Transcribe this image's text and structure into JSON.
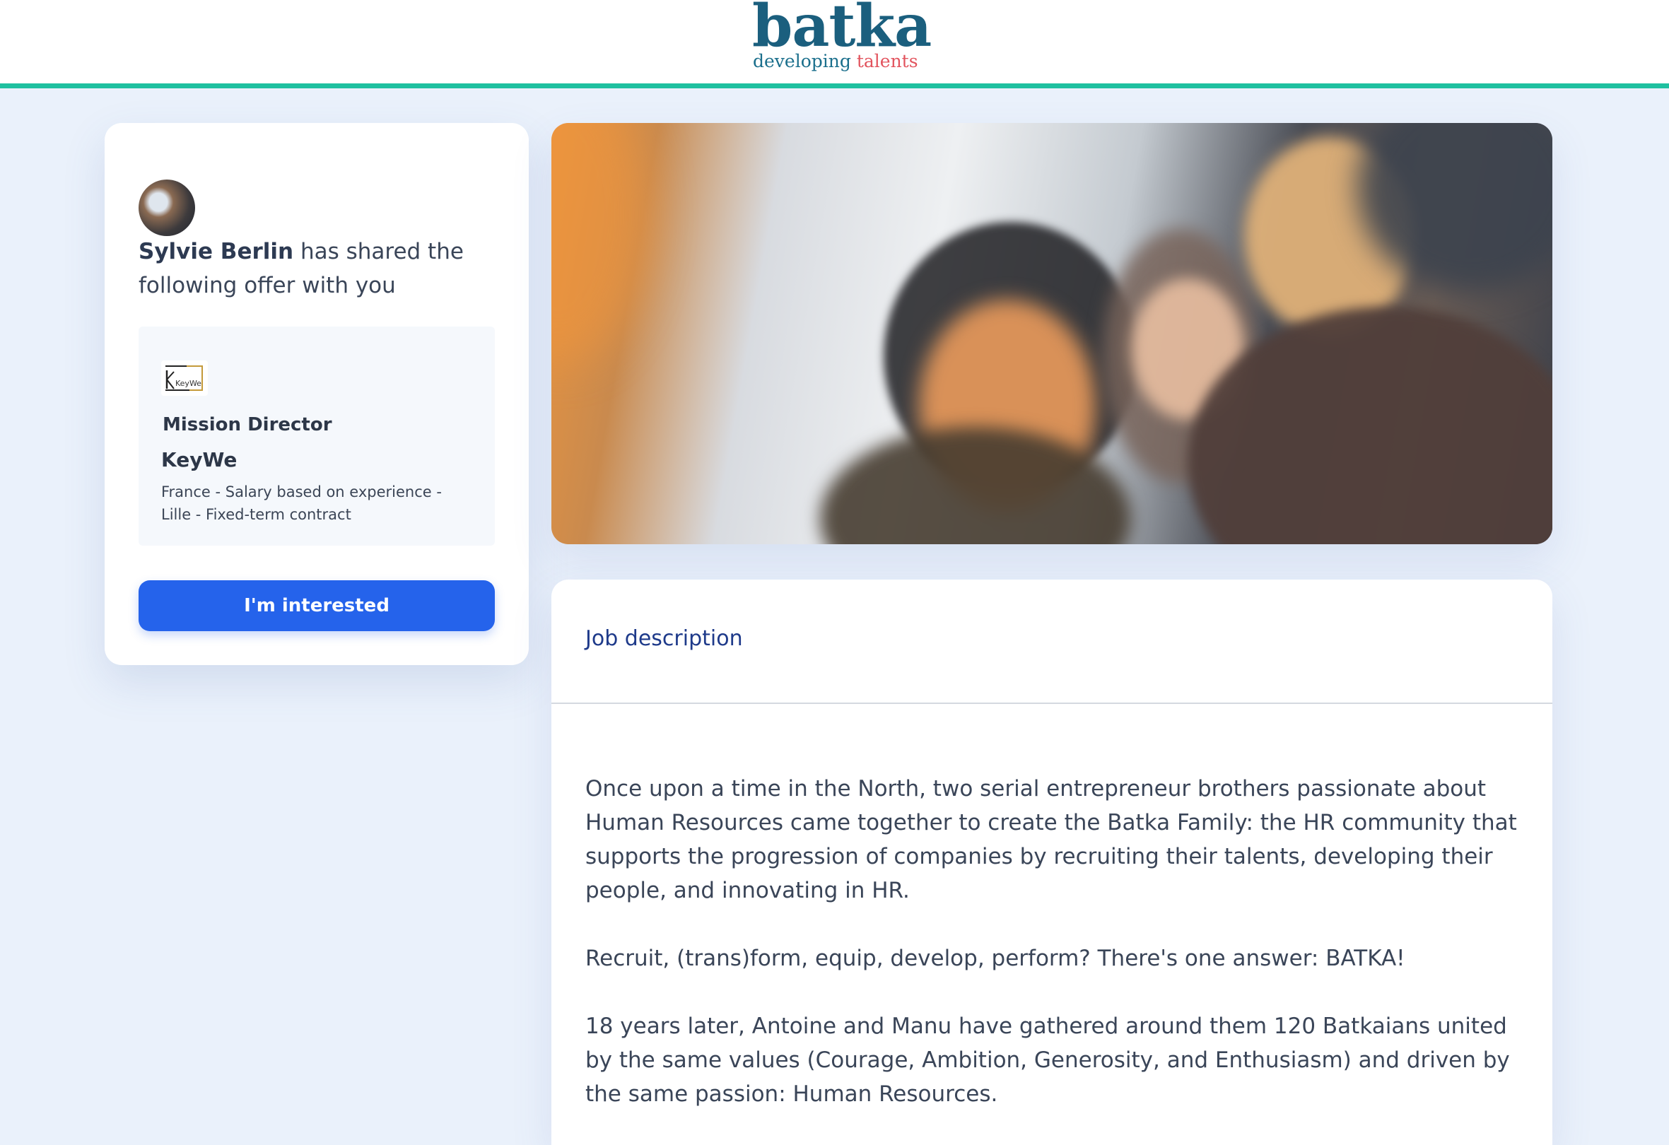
{
  "header": {
    "logo_word": "batka",
    "logo_tag_part1": "developing",
    "logo_tag_part2": "talents",
    "accent_color": "#1fc0a0"
  },
  "share_card": {
    "sharer_name": "Sylvie Berlin",
    "share_message": "has shared the following offer with you",
    "offer": {
      "company_logo_text": "KeyWe",
      "job_title": "Mission Director",
      "company": "KeyWe",
      "meta": "France - Salary based on experience - Lille - Fixed-term contract"
    },
    "cta_label": "I'm interested",
    "cta_color": "#2563eb"
  },
  "description": {
    "title": "Job description",
    "paragraphs": [
      "Once upon a time in the North, two serial entrepreneur brothers passionate about Human Resources came together to create the Batka Family: the HR community that supports the progression of companies by recruiting their talents, developing their people, and innovating in HR.",
      "Recruit, (trans)form, equip, develop, perform? There's one answer: BATKA!",
      "18 years later, Antoine and Manu have gathered around them 120 Batkaians united by the same values (Courage, Ambition, Generosity, and Enthusiasm) and driven by the same passion: Human Resources."
    ]
  }
}
